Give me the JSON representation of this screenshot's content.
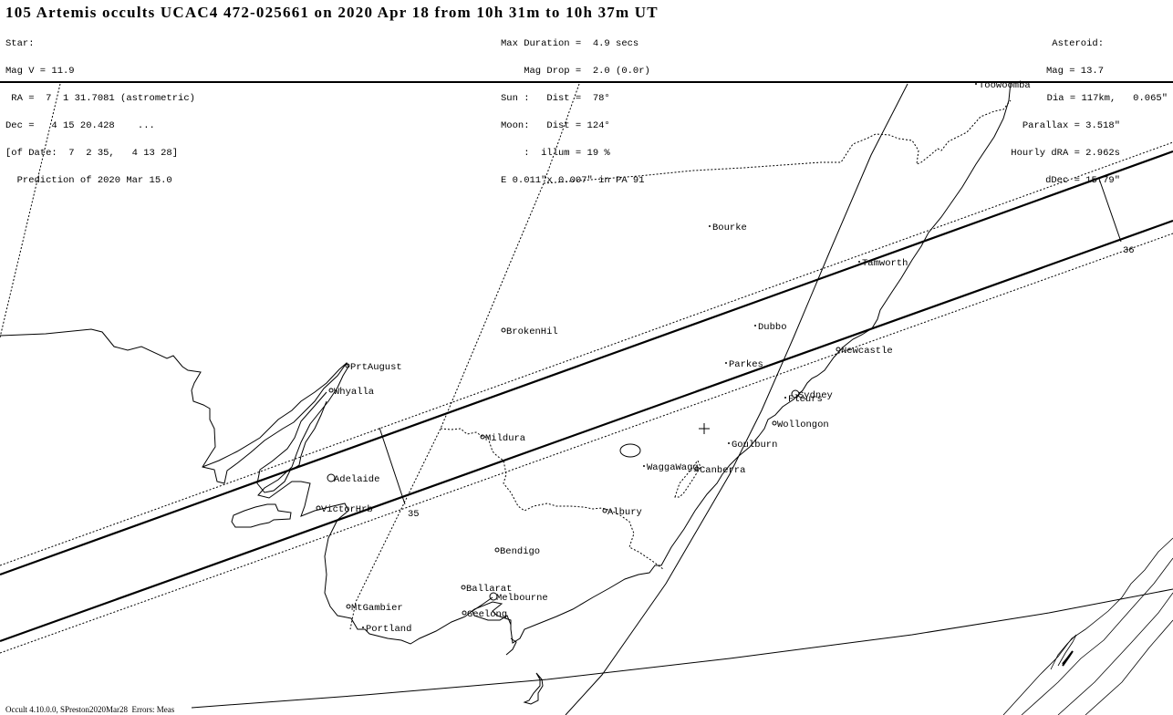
{
  "title": "105 Artemis occults UCAC4 472-025661 on 2020 Apr 18 from 10h 31m to 10h 37m UT",
  "star_block": [
    "Star:",
    "Mag V = 11.9",
    " RA =  7  1 31.7081 (astrometric)",
    "Dec =   4 15 20.428    ...",
    "[of Date:  7  2 35,   4 13 28]",
    "  Prediction of 2020 Mar 15.0"
  ],
  "event_block": [
    "Max Duration =  4.9 secs",
    "    Mag Drop =  2.0 (0.0r)",
    "Sun :   Dist =  78°",
    "Moon:   Dist = 124°",
    "    :  illum = 19 %",
    "E 0.011\"x 0.007\" in PA 91"
  ],
  "asteroid_block": [
    "Asteroid:",
    "Mag = 13.7",
    "Dia = 117km,   0.065\"",
    "Parallax = 3.518\"",
    "Hourly dRA = 2.962s",
    "dDec = 15.79\""
  ],
  "map": {
    "path_time_labels": [
      "35",
      "36"
    ],
    "cities": [
      {
        "name": "Toowoomba",
        "marker": "dot"
      },
      {
        "name": "Bourke",
        "marker": "dot"
      },
      {
        "name": "Tamworth",
        "marker": "dot"
      },
      {
        "name": "BrokenHil",
        "marker": "ring"
      },
      {
        "name": "Dubbo",
        "marker": "dot"
      },
      {
        "name": "Newcastle",
        "marker": "ring"
      },
      {
        "name": "PrtAugust",
        "marker": "ring"
      },
      {
        "name": "Parkes",
        "marker": "dot"
      },
      {
        "name": "Whyalla",
        "marker": "ring"
      },
      {
        "name": "Sydney",
        "marker": "big-ring"
      },
      {
        "name": "Fleurs",
        "marker": "dot"
      },
      {
        "name": "Wollongon",
        "marker": "ring"
      },
      {
        "name": "Mildura",
        "marker": "ring"
      },
      {
        "name": "Goulburn",
        "marker": "dot"
      },
      {
        "name": "WaggaWagg",
        "marker": "dot"
      },
      {
        "name": "Canberra",
        "marker": "ring"
      },
      {
        "name": "Adelaide",
        "marker": "big-ring"
      },
      {
        "name": "VictorHrb",
        "marker": "ring"
      },
      {
        "name": "Albury",
        "marker": "ring"
      },
      {
        "name": "Bendigo",
        "marker": "ring"
      },
      {
        "name": "Ballarat",
        "marker": "ring"
      },
      {
        "name": "Melbourne",
        "marker": "big-ring"
      },
      {
        "name": "Geelong",
        "marker": "ring"
      },
      {
        "name": "MtGambier",
        "marker": "ring"
      },
      {
        "name": "Portland",
        "marker": "dot"
      }
    ]
  },
  "footer": "Occult 4.10.0.0, SPreston2020Mar28  Errors: Meas"
}
